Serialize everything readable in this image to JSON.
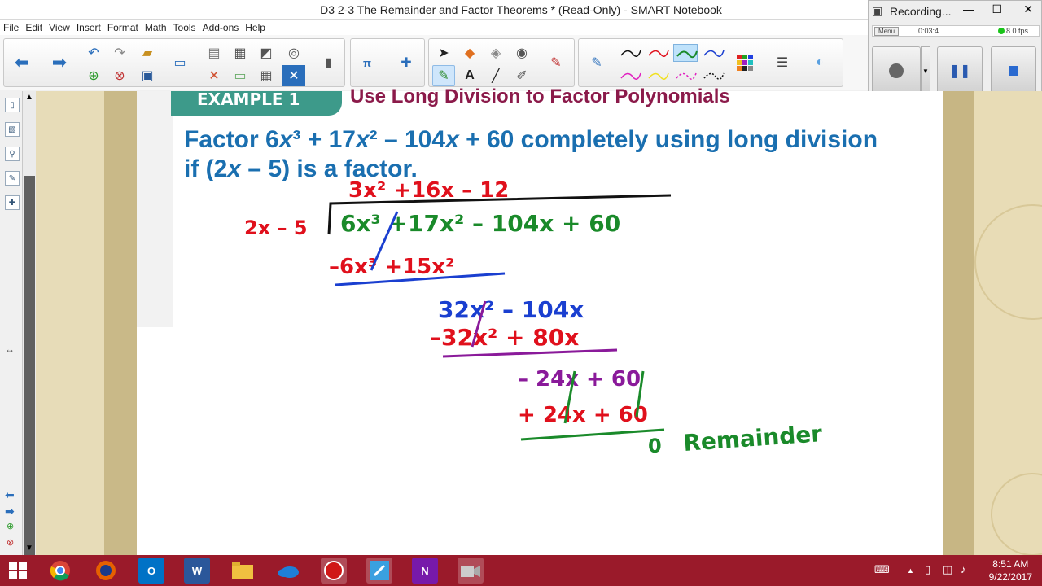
{
  "window": {
    "title": "D3 2-3 The Remainder and Factor Theorems * (Read-Only) - SMART Notebook",
    "minimize": "—",
    "maximize": "☐",
    "close": "✕"
  },
  "menu": [
    "File",
    "Edit",
    "View",
    "Insert",
    "Format",
    "Math",
    "Tools",
    "Add-ons",
    "Help"
  ],
  "recorder": {
    "title": "Recording...",
    "menu_label": "Menu",
    "time": "0:03:4",
    "fps": "8.0 fps"
  },
  "slide": {
    "example_label": "EXAMPLE 1",
    "lesson_title": "Use Long Division to Factor Polynomials",
    "problem_line1_a": "Factor 6",
    "problem_line1_b": "x",
    "problem_line1_c": "³ + 17",
    "problem_line1_d": "x",
    "problem_line1_e": "² – 104",
    "problem_line1_f": "x",
    "problem_line1_g": " + 60 completely using long division",
    "problem_line2_a": "if (2",
    "problem_line2_b": "x",
    "problem_line2_c": " – 5) is a factor."
  },
  "handwriting": {
    "quotient": "3x² +16x – 12",
    "divisor": "2x – 5",
    "dividend": "6x³ +17x² – 104x + 60",
    "step1": "–6x³ +15x²",
    "step2": "32x² – 104x",
    "step3": "–32x² + 80x",
    "step4": "– 24x + 60",
    "step5": "+ 24x + 60",
    "remainder_value": "0",
    "remainder_label": "Remainder"
  },
  "taskbar": {
    "time": "8:51 AM",
    "date": "9/22/2017"
  },
  "colors": {
    "problem_blue": "#1a6fb0",
    "title_maroon": "#8b1a4a",
    "ink_red": "#e0101c",
    "ink_green": "#1a8a2a",
    "ink_blue": "#1a3fd0",
    "ink_purple": "#8a1a9a",
    "taskbar": "#9a1a2a"
  }
}
